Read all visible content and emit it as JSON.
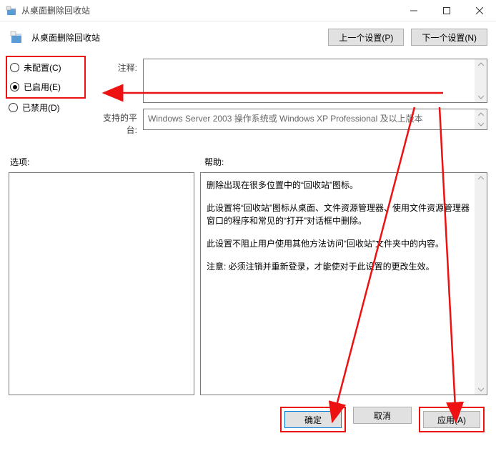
{
  "window": {
    "title": "从桌面删除回收站"
  },
  "header": {
    "title": "从桌面删除回收站",
    "prev_label": "上一个设置(P)",
    "next_label": "下一个设置(N)"
  },
  "radios": {
    "not_configured": "未配置(C)",
    "enabled": "已启用(E)",
    "disabled": "已禁用(D)",
    "selected": "enabled"
  },
  "info": {
    "comment_label": "注释:",
    "comment_value": "",
    "platform_label": "支持的平台:",
    "platform_value": "Windows Server 2003 操作系统或 Windows XP Professional 及以上版本"
  },
  "labels": {
    "options": "选项:",
    "help": "帮助:"
  },
  "help_text": {
    "p1": "删除出现在很多位置中的“回收站”图标。",
    "p2": "此设置将“回收站”图标从桌面、文件资源管理器、使用文件资源管理器窗口的程序和常见的“打开”对话框中删除。",
    "p3": "此设置不阻止用户使用其他方法访问“回收站”文件夹中的内容。",
    "p4": "注意: 必须注销并重新登录，才能使对于此设置的更改生效。"
  },
  "footer": {
    "ok": "确定",
    "cancel": "取消",
    "apply": "应用(A)"
  }
}
